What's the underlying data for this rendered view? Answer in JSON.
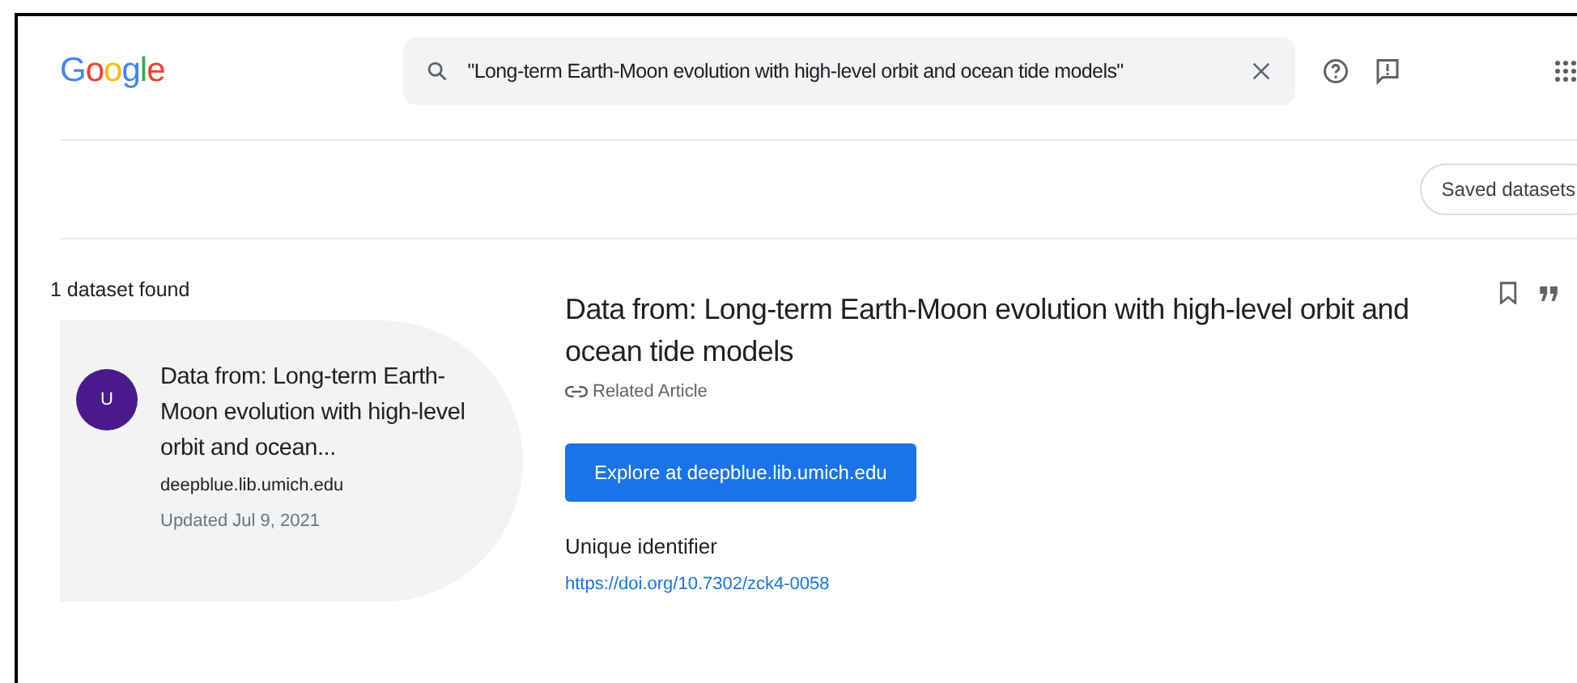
{
  "header": {
    "logo": "Google",
    "search": {
      "value": "\"Long-term Earth-Moon evolution with high-level orbit and ocean tide models\""
    }
  },
  "toolbar": {
    "saved_button": "Saved datasets"
  },
  "results": {
    "count": "1 dataset found",
    "items": [
      {
        "avatar": "U",
        "title": "Data from: Long-term Earth-Moon evolution with high-level orbit and ocean...",
        "source": "deepblue.lib.umich.edu",
        "updated": "Updated Jul 9, 2021",
        "selected": true
      }
    ]
  },
  "detail": {
    "title": "Data from: Long-term Earth-Moon evolution with high-level orbit and ocean tide models",
    "related": "Related Article",
    "explore_button": "Explore at deepblue.lib.umich.edu",
    "identifier_label": "Unique identifier",
    "identifier_link": "https://doi.org/10.7302/zck4-0058"
  }
}
